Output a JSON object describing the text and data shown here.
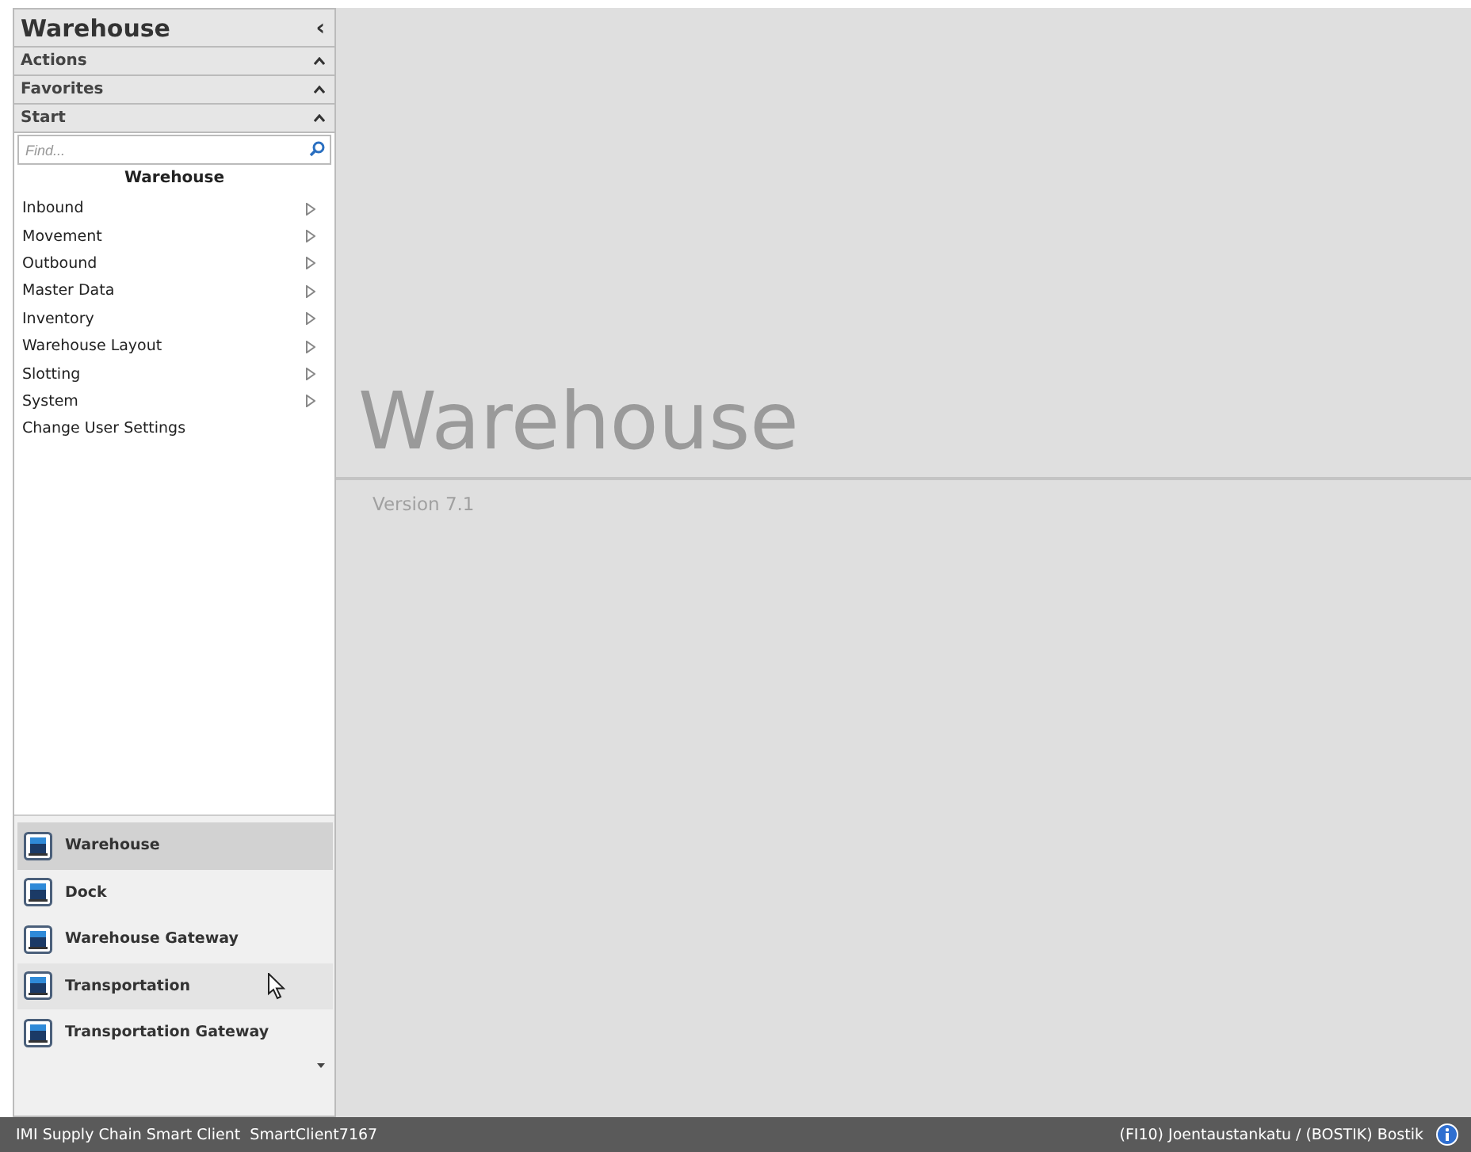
{
  "sidebar": {
    "title": "Warehouse",
    "collapse_glyph": "‹",
    "sections": [
      {
        "label": "Actions",
        "expanded": true
      },
      {
        "label": "Favorites",
        "expanded": true
      },
      {
        "label": "Start",
        "expanded": true
      }
    ],
    "search": {
      "placeholder": "Find..."
    },
    "menu_title": "Warehouse",
    "menu": [
      {
        "label": "Inbound",
        "kind": "submenu"
      },
      {
        "label": "Movement",
        "kind": "submenu"
      },
      {
        "label": "Outbound",
        "kind": "submenu"
      },
      {
        "label": "Master Data",
        "kind": "submenu"
      },
      {
        "label": "Inventory",
        "kind": "submenu"
      },
      {
        "label": "Warehouse Layout",
        "kind": "submenu"
      },
      {
        "label": "Slotting",
        "kind": "submenu"
      },
      {
        "label": "System",
        "kind": "submenu"
      },
      {
        "label": "Change User Settings",
        "kind": "command"
      }
    ],
    "apps": [
      {
        "label": "Warehouse",
        "selected": true,
        "hovered": false
      },
      {
        "label": "Dock",
        "selected": false,
        "hovered": false
      },
      {
        "label": "Warehouse Gateway",
        "selected": false,
        "hovered": false
      },
      {
        "label": "Transportation",
        "selected": false,
        "hovered": true
      },
      {
        "label": "Transportation Gateway",
        "selected": false,
        "hovered": false
      }
    ]
  },
  "main": {
    "title": "Warehouse",
    "version": "Version 7.1"
  },
  "status_bar": {
    "left": "IMI Supply Chain Smart Client  SmartClient7167",
    "right": "(FI10) Joentaustankatu / (BOSTIK) Bostik"
  }
}
